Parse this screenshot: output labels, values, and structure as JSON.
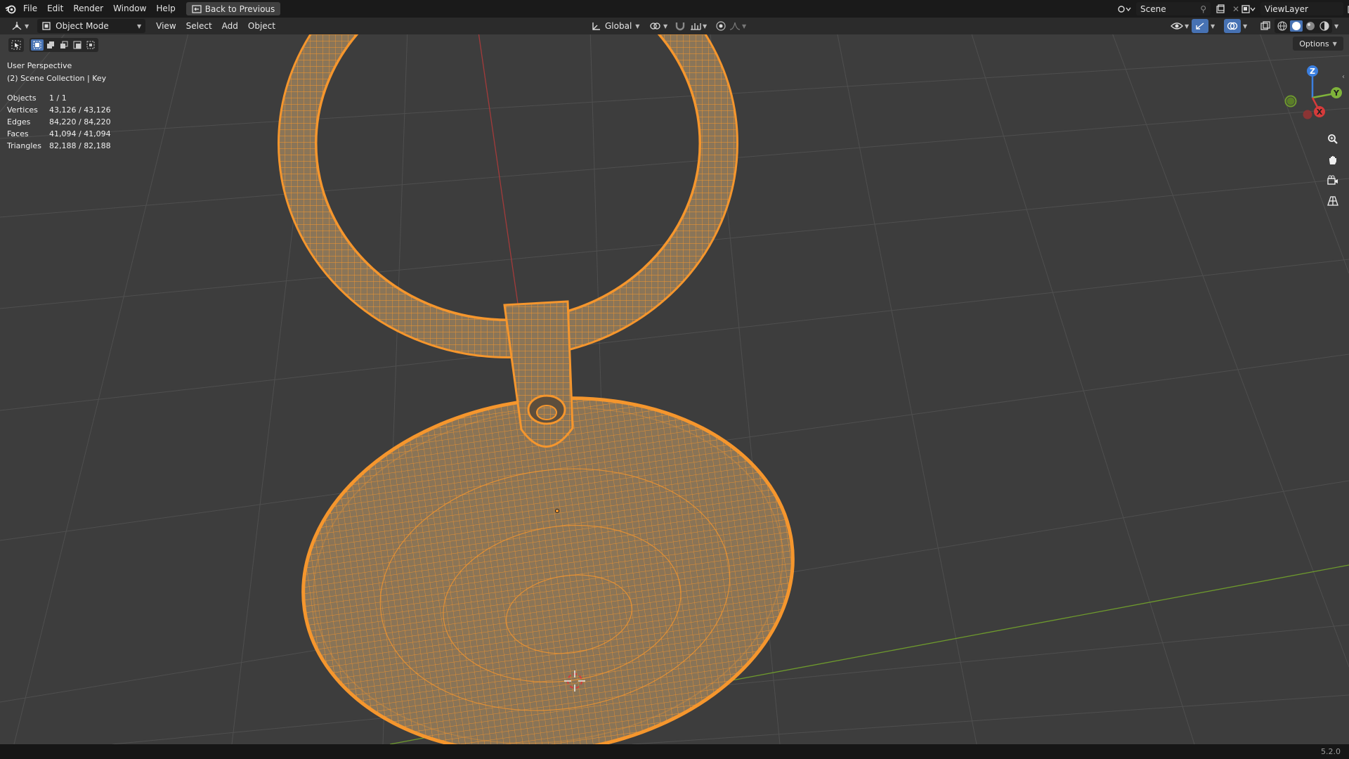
{
  "menu": {
    "items": [
      "File",
      "Edit",
      "Render",
      "Window",
      "Help"
    ],
    "back_button": "Back to Previous"
  },
  "scene_selector": {
    "value": "Scene"
  },
  "viewlayer_selector": {
    "value": "ViewLayer"
  },
  "header": {
    "mode": "Object Mode",
    "menus": [
      "View",
      "Select",
      "Add",
      "Object"
    ],
    "transform_orientation": "Global",
    "options_label": "Options"
  },
  "viewport_info": {
    "perspective": "User Perspective",
    "collection": "(2) Scene Collection | Key"
  },
  "stats": [
    {
      "label": "Objects",
      "value": "1 / 1"
    },
    {
      "label": "Vertices",
      "value": "43,126 / 43,126"
    },
    {
      "label": "Edges",
      "value": "84,220 / 84,220"
    },
    {
      "label": "Faces",
      "value": "41,094 / 41,094"
    },
    {
      "label": "Triangles",
      "value": "82,188 / 82,188"
    }
  ],
  "gizmo": {
    "x_label": "X",
    "y_label": "Y",
    "z_label": "Z"
  },
  "status": {
    "version": "5.2.0"
  },
  "colors": {
    "selection": "#f5962d",
    "x_axis": "#d63b3b",
    "y_axis": "#7fb33a",
    "z_axis": "#3b7fe0",
    "active_button": "#4772b3"
  }
}
